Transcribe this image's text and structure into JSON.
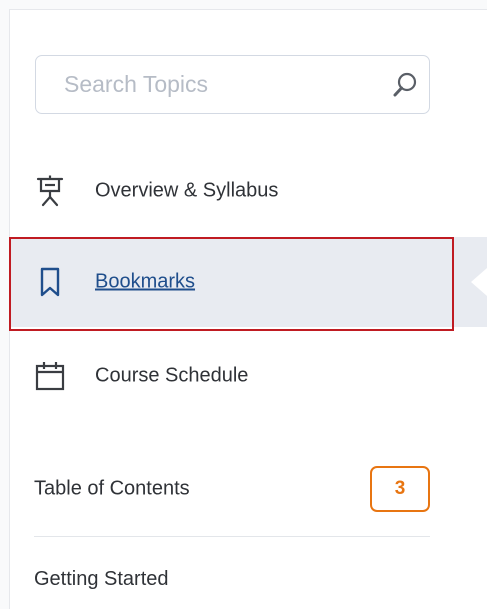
{
  "search": {
    "placeholder": "Search Topics",
    "value": "",
    "icon": "search-icon"
  },
  "nav": {
    "items": [
      {
        "label": "Overview & Syllabus",
        "icon": "presentation-board-icon",
        "selected": false
      },
      {
        "label": "Bookmarks",
        "icon": "bookmark-icon",
        "selected": true
      },
      {
        "label": "Course Schedule",
        "icon": "calendar-icon",
        "selected": false
      }
    ]
  },
  "toc": {
    "label": "Table of Contents",
    "count": "3"
  },
  "modules": [
    {
      "label": "Getting Started"
    }
  ],
  "colors": {
    "selected_bg": "#e8ebf1",
    "selected_outline": "#c01b22",
    "link": "#1f4e8c",
    "badge": "#e87511"
  }
}
